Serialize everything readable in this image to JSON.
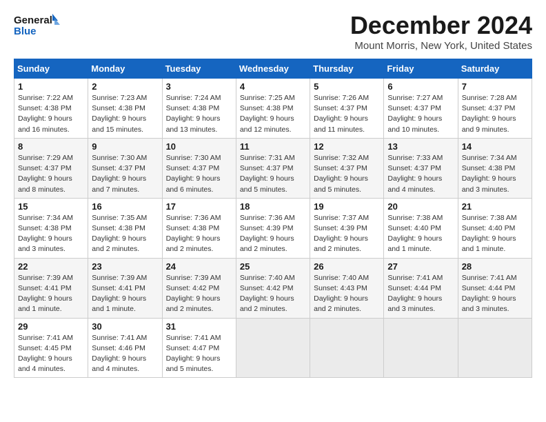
{
  "header": {
    "logo_line1": "General",
    "logo_line2": "Blue",
    "title": "December 2024",
    "subtitle": "Mount Morris, New York, United States"
  },
  "weekdays": [
    "Sunday",
    "Monday",
    "Tuesday",
    "Wednesday",
    "Thursday",
    "Friday",
    "Saturday"
  ],
  "weeks": [
    [
      {
        "num": "1",
        "sunrise": "7:22 AM",
        "sunset": "4:38 PM",
        "daylight": "9 hours and 16 minutes."
      },
      {
        "num": "2",
        "sunrise": "7:23 AM",
        "sunset": "4:38 PM",
        "daylight": "9 hours and 15 minutes."
      },
      {
        "num": "3",
        "sunrise": "7:24 AM",
        "sunset": "4:38 PM",
        "daylight": "9 hours and 13 minutes."
      },
      {
        "num": "4",
        "sunrise": "7:25 AM",
        "sunset": "4:38 PM",
        "daylight": "9 hours and 12 minutes."
      },
      {
        "num": "5",
        "sunrise": "7:26 AM",
        "sunset": "4:37 PM",
        "daylight": "9 hours and 11 minutes."
      },
      {
        "num": "6",
        "sunrise": "7:27 AM",
        "sunset": "4:37 PM",
        "daylight": "9 hours and 10 minutes."
      },
      {
        "num": "7",
        "sunrise": "7:28 AM",
        "sunset": "4:37 PM",
        "daylight": "9 hours and 9 minutes."
      }
    ],
    [
      {
        "num": "8",
        "sunrise": "7:29 AM",
        "sunset": "4:37 PM",
        "daylight": "9 hours and 8 minutes."
      },
      {
        "num": "9",
        "sunrise": "7:30 AM",
        "sunset": "4:37 PM",
        "daylight": "9 hours and 7 minutes."
      },
      {
        "num": "10",
        "sunrise": "7:30 AM",
        "sunset": "4:37 PM",
        "daylight": "9 hours and 6 minutes."
      },
      {
        "num": "11",
        "sunrise": "7:31 AM",
        "sunset": "4:37 PM",
        "daylight": "9 hours and 5 minutes."
      },
      {
        "num": "12",
        "sunrise": "7:32 AM",
        "sunset": "4:37 PM",
        "daylight": "9 hours and 5 minutes."
      },
      {
        "num": "13",
        "sunrise": "7:33 AM",
        "sunset": "4:37 PM",
        "daylight": "9 hours and 4 minutes."
      },
      {
        "num": "14",
        "sunrise": "7:34 AM",
        "sunset": "4:38 PM",
        "daylight": "9 hours and 3 minutes."
      }
    ],
    [
      {
        "num": "15",
        "sunrise": "7:34 AM",
        "sunset": "4:38 PM",
        "daylight": "9 hours and 3 minutes."
      },
      {
        "num": "16",
        "sunrise": "7:35 AM",
        "sunset": "4:38 PM",
        "daylight": "9 hours and 2 minutes."
      },
      {
        "num": "17",
        "sunrise": "7:36 AM",
        "sunset": "4:38 PM",
        "daylight": "9 hours and 2 minutes."
      },
      {
        "num": "18",
        "sunrise": "7:36 AM",
        "sunset": "4:39 PM",
        "daylight": "9 hours and 2 minutes."
      },
      {
        "num": "19",
        "sunrise": "7:37 AM",
        "sunset": "4:39 PM",
        "daylight": "9 hours and 2 minutes."
      },
      {
        "num": "20",
        "sunrise": "7:38 AM",
        "sunset": "4:40 PM",
        "daylight": "9 hours and 1 minute."
      },
      {
        "num": "21",
        "sunrise": "7:38 AM",
        "sunset": "4:40 PM",
        "daylight": "9 hours and 1 minute."
      }
    ],
    [
      {
        "num": "22",
        "sunrise": "7:39 AM",
        "sunset": "4:41 PM",
        "daylight": "9 hours and 1 minute."
      },
      {
        "num": "23",
        "sunrise": "7:39 AM",
        "sunset": "4:41 PM",
        "daylight": "9 hours and 1 minute."
      },
      {
        "num": "24",
        "sunrise": "7:39 AM",
        "sunset": "4:42 PM",
        "daylight": "9 hours and 2 minutes."
      },
      {
        "num": "25",
        "sunrise": "7:40 AM",
        "sunset": "4:42 PM",
        "daylight": "9 hours and 2 minutes."
      },
      {
        "num": "26",
        "sunrise": "7:40 AM",
        "sunset": "4:43 PM",
        "daylight": "9 hours and 2 minutes."
      },
      {
        "num": "27",
        "sunrise": "7:41 AM",
        "sunset": "4:44 PM",
        "daylight": "9 hours and 3 minutes."
      },
      {
        "num": "28",
        "sunrise": "7:41 AM",
        "sunset": "4:44 PM",
        "daylight": "9 hours and 3 minutes."
      }
    ],
    [
      {
        "num": "29",
        "sunrise": "7:41 AM",
        "sunset": "4:45 PM",
        "daylight": "9 hours and 4 minutes."
      },
      {
        "num": "30",
        "sunrise": "7:41 AM",
        "sunset": "4:46 PM",
        "daylight": "9 hours and 4 minutes."
      },
      {
        "num": "31",
        "sunrise": "7:41 AM",
        "sunset": "4:47 PM",
        "daylight": "9 hours and 5 minutes."
      },
      null,
      null,
      null,
      null
    ]
  ],
  "labels": {
    "sunrise": "Sunrise:",
    "sunset": "Sunset:",
    "daylight": "Daylight:"
  }
}
